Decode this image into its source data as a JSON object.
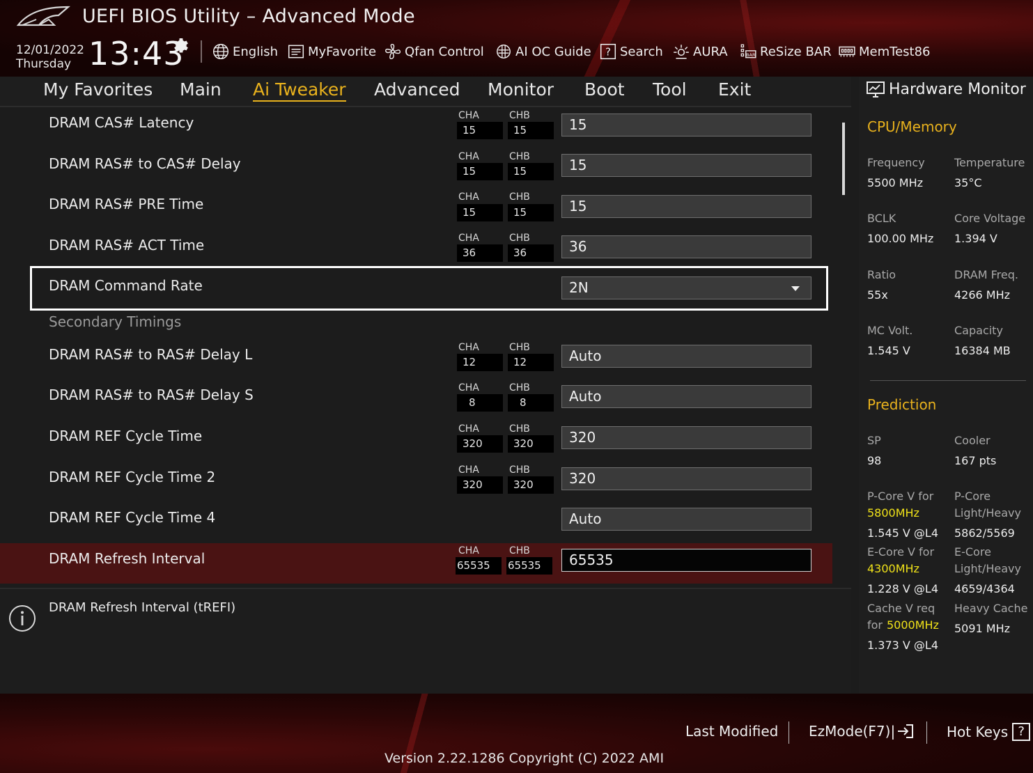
{
  "header": {
    "title": "UEFI BIOS Utility – Advanced Mode",
    "date": "12/01/2022",
    "weekday": "Thursday",
    "time": "13:43",
    "tools": [
      {
        "label": "English",
        "icon": "globe-icon"
      },
      {
        "label": "MyFavorite",
        "icon": "favorite-list-icon"
      },
      {
        "label": "Qfan Control",
        "icon": "fan-icon"
      },
      {
        "label": "AI OC Guide",
        "icon": "ai-guide-icon"
      },
      {
        "label": "Search",
        "icon": "search-icon"
      },
      {
        "label": "AURA",
        "icon": "aura-icon"
      },
      {
        "label": "ReSize BAR",
        "icon": "resize-bar-icon"
      },
      {
        "label": "MemTest86",
        "icon": "memtest-icon"
      }
    ]
  },
  "menu": {
    "tabs": [
      "My Favorites",
      "Main",
      "Ai Tweaker",
      "Advanced",
      "Monitor",
      "Boot",
      "Tool",
      "Exit"
    ],
    "active": "Ai Tweaker"
  },
  "channels": {
    "a": "CHA",
    "b": "CHB"
  },
  "settings": [
    {
      "label": "DRAM CAS# Latency",
      "cha": "15",
      "chb": "15",
      "value": "15"
    },
    {
      "label": "DRAM RAS# to CAS# Delay",
      "cha": "15",
      "chb": "15",
      "value": "15"
    },
    {
      "label": "DRAM RAS# PRE Time",
      "cha": "15",
      "chb": "15",
      "value": "15"
    },
    {
      "label": "DRAM RAS# ACT Time",
      "cha": "36",
      "chb": "36",
      "value": "36"
    },
    {
      "label": "DRAM Command Rate",
      "value": "2N"
    },
    {
      "label": "DRAM RAS# to RAS# Delay L",
      "cha": "12",
      "chb": "12",
      "value": "Auto"
    },
    {
      "label": "DRAM RAS# to RAS# Delay S",
      "cha": "8",
      "chb": "8",
      "value": "Auto"
    },
    {
      "label": "DRAM REF Cycle Time",
      "cha": "320",
      "chb": "320",
      "value": "320"
    },
    {
      "label": "DRAM REF Cycle Time 2",
      "cha": "320",
      "chb": "320",
      "value": "320"
    },
    {
      "label": "DRAM REF Cycle Time 4",
      "value": "Auto"
    },
    {
      "label": "DRAM Refresh Interval",
      "cha": "65535",
      "chb": "65535",
      "value": "65535"
    }
  ],
  "section_secondary": "Secondary Timings",
  "help": {
    "text": "DRAM Refresh Interval (tREFI)"
  },
  "hw": {
    "title": "Hardware Monitor",
    "cpu_section": "CPU/Memory",
    "frequency_label": "Frequency",
    "frequency": "5500 MHz",
    "temperature_label": "Temperature",
    "temperature": "35°C",
    "bclk_label": "BCLK",
    "bclk": "100.00 MHz",
    "core_voltage_label": "Core Voltage",
    "core_voltage": "1.394 V",
    "ratio_label": "Ratio",
    "ratio": "55x",
    "dram_freq_label": "DRAM Freq.",
    "dram_freq": "4266 MHz",
    "mc_volt_label": "MC Volt.",
    "mc_volt": "1.545 V",
    "capacity_label": "Capacity",
    "capacity": "16384 MB",
    "prediction_section": "Prediction",
    "sp_label": "SP",
    "sp": "98",
    "cooler_label": "Cooler",
    "cooler": "167 pts",
    "pcore_v_label": "P-Core V for",
    "pcore_v_freq": "5800MHz",
    "pcore_v": "1.545 V @L4",
    "pcore_label": "P-Core",
    "pcore_lh_label": "Light/Heavy",
    "pcore_lh": "5862/5569",
    "ecore_v_label": "E-Core V for",
    "ecore_v_freq": "4300MHz",
    "ecore_v": "1.228 V @L4",
    "ecore_label": "E-Core",
    "ecore_lh_label": "Light/Heavy",
    "ecore_lh": "4659/4364",
    "cache_v_label": "Cache V req",
    "cache_v_for": "for",
    "cache_v_freq": "5000MHz",
    "cache_v": "1.373 V @L4",
    "heavy_cache_label": "Heavy Cache",
    "heavy_cache": "5091 MHz"
  },
  "footer": {
    "last_modified": "Last Modified",
    "ezmode": "EzMode(F7)|",
    "hotkeys": "Hot Keys",
    "hotkeys_key": "?",
    "version": "Version 2.22.1286 Copyright (C) 2022 AMI"
  },
  "colors": {
    "accent": "#e9b21d",
    "selected_row": "#4a1313",
    "highlight_yellow": "#f0e219"
  }
}
